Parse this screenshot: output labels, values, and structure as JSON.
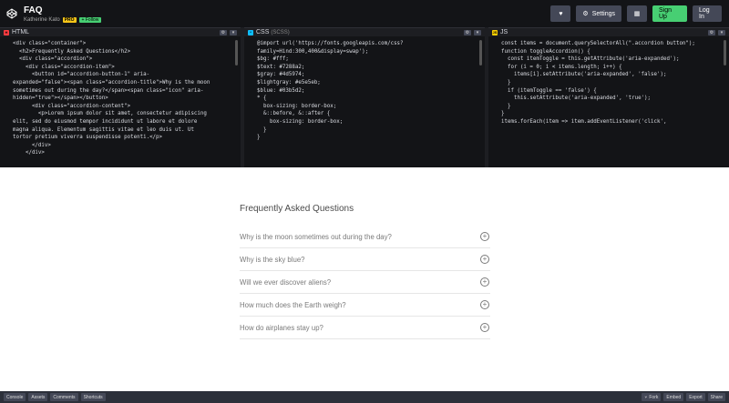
{
  "header": {
    "title": "FAQ",
    "author": "Katherine Kato",
    "pro_badge": "PRO",
    "follow_badge": "+ Follow",
    "settings_label": "Settings",
    "signup_label": "Sign Up",
    "login_label": "Log In"
  },
  "panes": {
    "html": {
      "label": "HTML",
      "sub": "",
      "icon_letter": "H",
      "lines": [
        "<div class=\"container\">",
        "  <h2>Frequently Asked Questions</h2>",
        "  <div class=\"accordion\">",
        "    <div class=\"accordion-item\">",
        "      <button id=\"accordion-button-1\" aria-",
        "expanded=\"false\"><span class=\"accordion-title\">Why is the moon",
        "sometimes out during the day?</span><span class=\"icon\" aria-",
        "hidden=\"true\"></span></button>",
        "      <div class=\"accordion-content\">",
        "        <p>Lorem ipsum dolor sit amet, consectetur adipiscing",
        "elit, sed do eiusmod tempor incididunt ut labore et dolore",
        "magna aliqua. Elementum sagittis vitae et leo duis ut. Ut",
        "tortor pretium viverra suspendisse potenti.</p>",
        "      </div>",
        "    </div>"
      ]
    },
    "css": {
      "label": "CSS",
      "sub": "(SCSS)",
      "icon_letter": "*",
      "lines": [
        "@import url('https://fonts.googleapis.com/css?",
        "family=Hind:300,400&display=swap');",
        "",
        "$bg: #fff;",
        "$text: #7288a2;",
        "$gray: #4d5974;",
        "$lightgray: #e5e5eb;",
        "$blue: #03b5d2;",
        "",
        "* {",
        "  box-sizing: border-box;",
        "  &::before, &::after {",
        "    box-sizing: border-box;",
        "  }",
        "}"
      ]
    },
    "js": {
      "label": "JS",
      "sub": "",
      "icon_letter": "JS",
      "lines": [
        "const items = document.querySelectorAll(\".accordion button\");",
        "",
        "function toggleAccordion() {",
        "  const itemToggle = this.getAttribute('aria-expanded');",
        "",
        "  for (i = 0; i < items.length; i++) {",
        "    items[i].setAttribute('aria-expanded', 'false');",
        "  }",
        "",
        "  if (itemToggle == 'false') {",
        "    this.setAttribute('aria-expanded', 'true');",
        "  }",
        "}",
        "",
        "items.forEach(item => item.addEventListener('click',"
      ]
    }
  },
  "faq": {
    "title": "Frequently Asked Questions",
    "questions": [
      "Why is the moon sometimes out during the day?",
      "Why is the sky blue?",
      "Will we ever discover aliens?",
      "How much does the Earth weigh?",
      "How do airplanes stay up?"
    ]
  },
  "footer": {
    "left": [
      "Console",
      "Assets",
      "Comments",
      "Shortcuts"
    ],
    "right": [
      "Fork",
      "Embed",
      "Export",
      "Share"
    ]
  }
}
